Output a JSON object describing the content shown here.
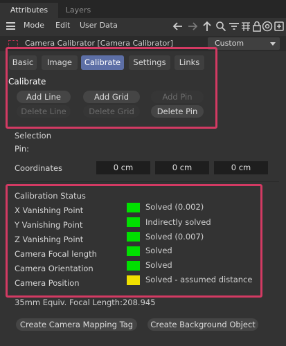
{
  "tabs": [
    {
      "label": "Attributes",
      "active": true
    },
    {
      "label": "Layers",
      "active": false
    }
  ],
  "menu": {
    "mode": "Mode",
    "edit": "Edit",
    "user_data": "User Data"
  },
  "toolbar_icons": [
    "back-arrow-icon",
    "forward-arrow-icon",
    "up-arrow-icon",
    "search-icon",
    "filter-icon",
    "grid-icon",
    "lock-icon",
    "target-icon",
    "new-panel-icon"
  ],
  "object": {
    "title": "Camera Calibrator [Camera Calibrator]",
    "layout_select": "Custom"
  },
  "subtabs": [
    {
      "label": "Basic",
      "active": false
    },
    {
      "label": "Image",
      "active": false
    },
    {
      "label": "Calibrate",
      "active": true
    },
    {
      "label": "Settings",
      "active": false
    },
    {
      "label": "Links",
      "active": false
    }
  ],
  "calibrate": {
    "title": "Calibrate",
    "add_line": "Add Line",
    "add_grid": "Add Grid",
    "add_pin": "Add Pin",
    "delete_line": "Delete Line",
    "delete_grid": "Delete Grid",
    "delete_pin": "Delete Pin"
  },
  "selection": {
    "title": "Selection",
    "pin_label": "Pin:",
    "coordinates_label": "Coordinates",
    "coord_x": "0 cm",
    "coord_y": "0 cm",
    "coord_z": "0 cm"
  },
  "status": {
    "title": "Calibration Status",
    "rows": [
      {
        "label": "X Vanishing Point",
        "value": "Solved (0.002)",
        "color": "#00e000"
      },
      {
        "label": "Y Vanishing Point",
        "value": "Indirectly solved",
        "color": "#00e000"
      },
      {
        "label": "Z Vanishing Point",
        "value": "Solved (0.007)",
        "color": "#00e000"
      },
      {
        "label": "Camera Focal length",
        "value": "Solved",
        "color": "#00e000"
      },
      {
        "label": "Camera Orientation",
        "value": "Solved",
        "color": "#00e000"
      },
      {
        "label": "Camera Position",
        "value": "Solved - assumed distance",
        "color": "#f0e000"
      }
    ]
  },
  "focal_info": "35mm Equiv. Focal Length:208.945",
  "actions": {
    "mapping_tag": "Create Camera Mapping Tag",
    "background_object": "Create Background Object"
  },
  "accent_color": "#d33a63",
  "active_tab_color": "#5d6fa6"
}
